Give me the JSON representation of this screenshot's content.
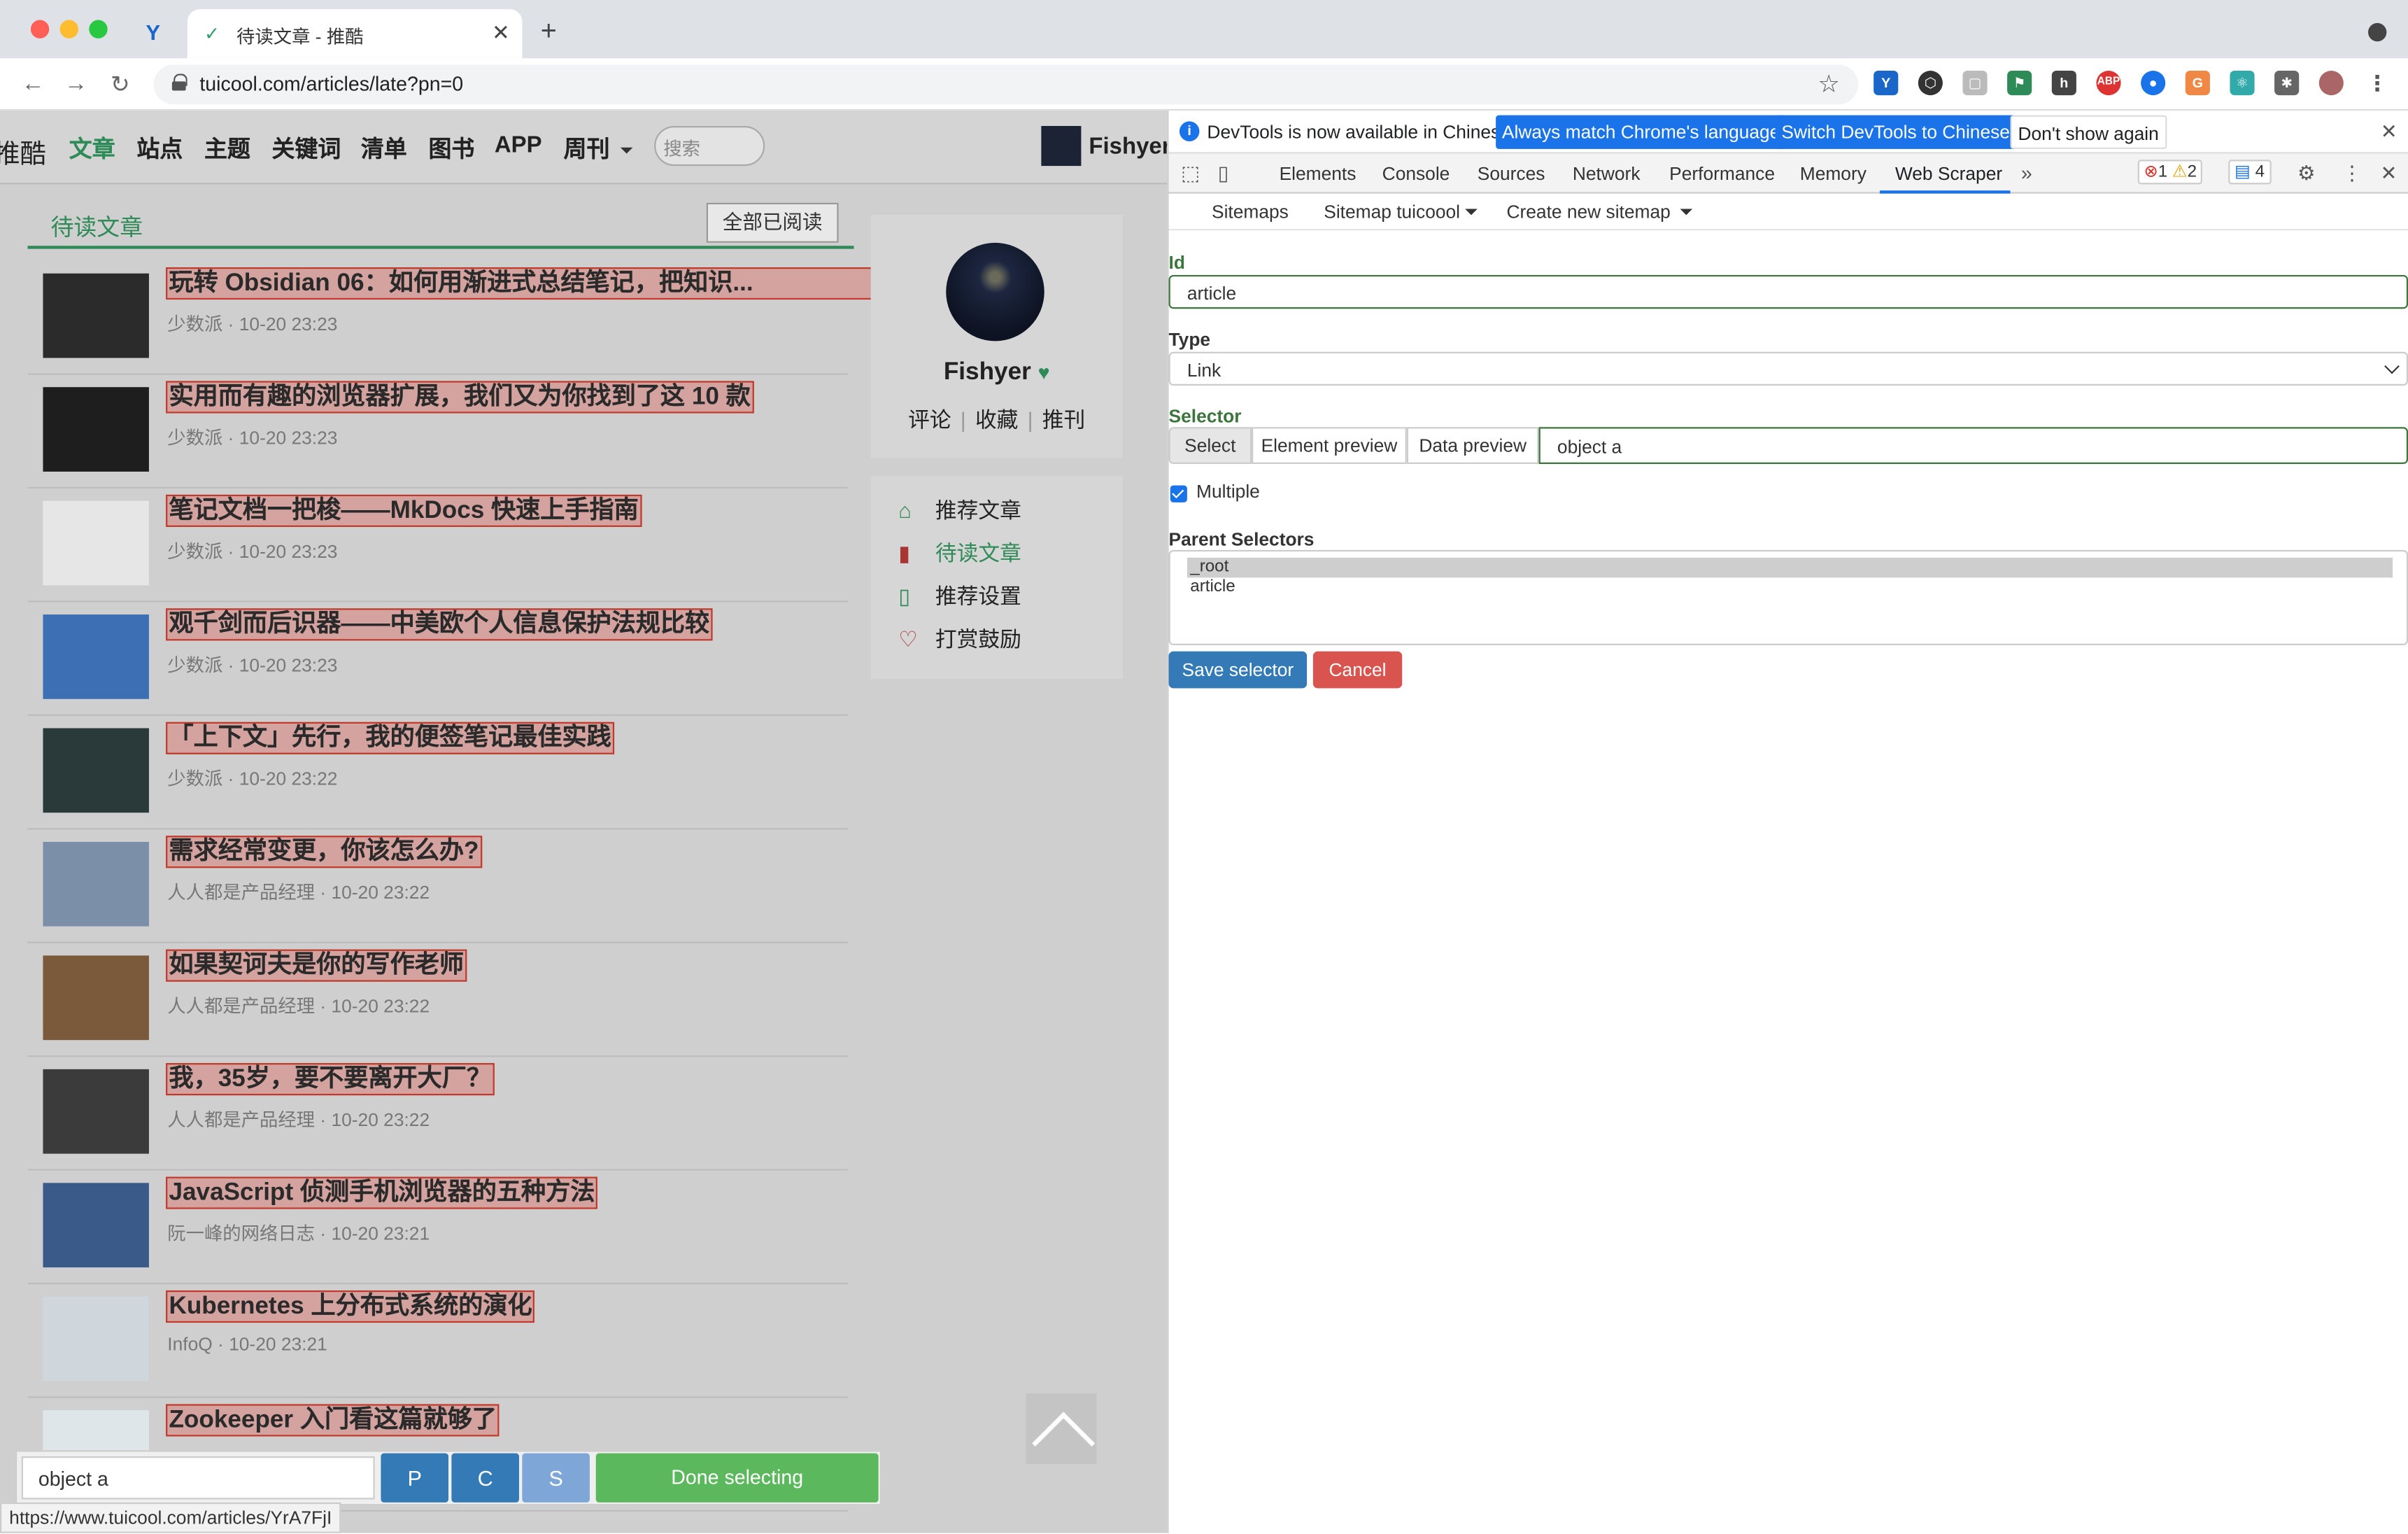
{
  "browser": {
    "tab_title": "待读文章 - 推酷",
    "url": "tuicool.com/articles/late?pn=0",
    "status_url": "https://www.tuicool.com/articles/YrA7FjI"
  },
  "site_nav": {
    "logo_partial": "推酷",
    "items": [
      "文章",
      "站点",
      "主题",
      "关键词",
      "清单",
      "图书",
      "APP",
      "周刊"
    ],
    "search_placeholder": "搜索",
    "user_name": "Fishyer"
  },
  "list": {
    "title": "待读文章",
    "mark_all_read": "全部已阅读",
    "articles": [
      {
        "title": "玩转 Obsidian 06：如何用渐进式总结笔记，把知识...",
        "source": "少数派",
        "time": "10-20 23:23"
      },
      {
        "title": "实用而有趣的浏览器扩展，我们又为你找到了这 10 款",
        "source": "少数派",
        "time": "10-20 23:23"
      },
      {
        "title": "笔记文档一把梭——MkDocs 快速上手指南",
        "source": "少数派",
        "time": "10-20 23:23"
      },
      {
        "title": "观千剑而后识器——中美欧个人信息保护法规比较",
        "source": "少数派",
        "time": "10-20 23:23"
      },
      {
        "title": "「上下文」先行，我的便签笔记最佳实践",
        "source": "少数派",
        "time": "10-20 23:22"
      },
      {
        "title": "需求经常变更，你该怎么办?",
        "source": "人人都是产品经理",
        "time": "10-20 23:22"
      },
      {
        "title": "如果契诃夫是你的写作老师",
        "source": "人人都是产品经理",
        "time": "10-20 23:22"
      },
      {
        "title": "我，35岁，要不要离开大厂？",
        "source": "人人都是产品经理",
        "time": "10-20 23:22"
      },
      {
        "title": "JavaScript 侦测手机浏览器的五种方法",
        "source": "阮一峰的网络日志",
        "time": "10-20 23:21"
      },
      {
        "title": "Kubernetes 上分布式系统的演化",
        "source": "InfoQ",
        "time": "10-20 23:21"
      },
      {
        "title": "Zookeeper 入门看这篇就够了",
        "source": "",
        "time": ""
      }
    ]
  },
  "sidebar": {
    "name": "Fishyer",
    "links": [
      "评论",
      "收藏",
      "推刊"
    ],
    "menu": [
      "推荐文章",
      "待读文章",
      "推荐设置",
      "打赏鼓励"
    ]
  },
  "selector_bar": {
    "input_value": "object a",
    "btn_p": "P",
    "btn_c": "C",
    "btn_s": "S",
    "done": "Done selecting"
  },
  "devtools": {
    "info_text": "DevTools is now available in Chinese!",
    "btn_match": "Always match Chrome's language",
    "btn_switch": "Switch DevTools to Chinese",
    "btn_dont_show": "Don't show again",
    "tabs": [
      "Elements",
      "Console",
      "Sources",
      "Network",
      "Performance",
      "Memory",
      "Web Scraper"
    ],
    "active_tab": "Web Scraper",
    "errors": "1",
    "warnings": "2",
    "messages": "4",
    "scraper_nav": [
      "Sitemaps",
      "Sitemap tuicoool",
      "Create new sitemap"
    ],
    "form": {
      "id_label": "Id",
      "id_value": "article",
      "type_label": "Type",
      "type_value": "Link",
      "selector_label": "Selector",
      "sel_btns": [
        "Select",
        "Element preview",
        "Data preview"
      ],
      "selector_value": "object a",
      "multiple_label": "Multiple",
      "parent_label": "Parent Selectors",
      "parent_options": [
        "_root",
        "article"
      ],
      "save": "Save selector",
      "cancel": "Cancel"
    }
  },
  "colors": {
    "accent_green": "#2e8b57",
    "highlight_red": "#c0392b",
    "devtools_blue": "#1a73e8",
    "save_blue": "#337ab7",
    "cancel_red": "#d9534f",
    "done_green": "#5cb85c"
  }
}
